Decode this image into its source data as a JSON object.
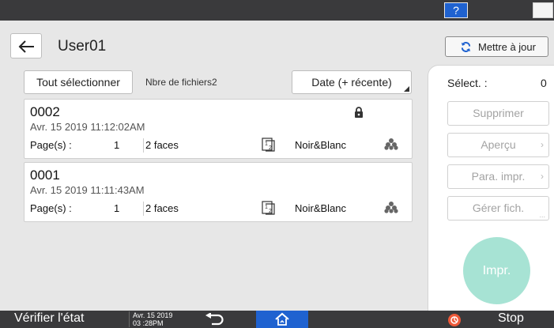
{
  "topbar": {
    "help_label": "?",
    "help_icon": "question-icon",
    "night_icon": "moon-icon",
    "accent": "#1f62d0"
  },
  "header": {
    "title": "User01",
    "back_icon": "back-arrow-icon",
    "refresh_label": "Mettre à jour",
    "refresh_icon": "refresh-icon",
    "refresh_color": "#1f62d0"
  },
  "toolbar": {
    "select_all_label": "Tout sélectionner",
    "file_count": "Nbre de fichiers2",
    "sort_label": "Date (+ récente)"
  },
  "files": [
    {
      "name": "0002",
      "date": "Avr. 15 2019 11:12:02AM",
      "pages_label": "Page(s) :",
      "pages": "1",
      "sides": "2 faces",
      "color_mode": "Noir&Blanc",
      "locked": true
    },
    {
      "name": "0001",
      "date": "Avr. 15 2019 11:11:43AM",
      "pages_label": "Page(s) :",
      "pages": "1",
      "sides": "2 faces",
      "color_mode": "Noir&Blanc",
      "locked": false
    }
  ],
  "side_panel": {
    "select_label": "Sélect. :",
    "select_count": "0",
    "delete_label": "Supprimer",
    "preview_label": "Aperçu",
    "print_settings_label": "Para. impr.",
    "manage_label": "Gérer fich.",
    "print_label": "Impr.",
    "print_color": "#a7e3d4"
  },
  "bottombar": {
    "check_status_label": "Vérifier l'état",
    "clock_date": "Avr. 15 2019",
    "clock_time": "03 :28PM",
    "stop_label": "Stop",
    "stop_color": "#ef5a3a"
  }
}
